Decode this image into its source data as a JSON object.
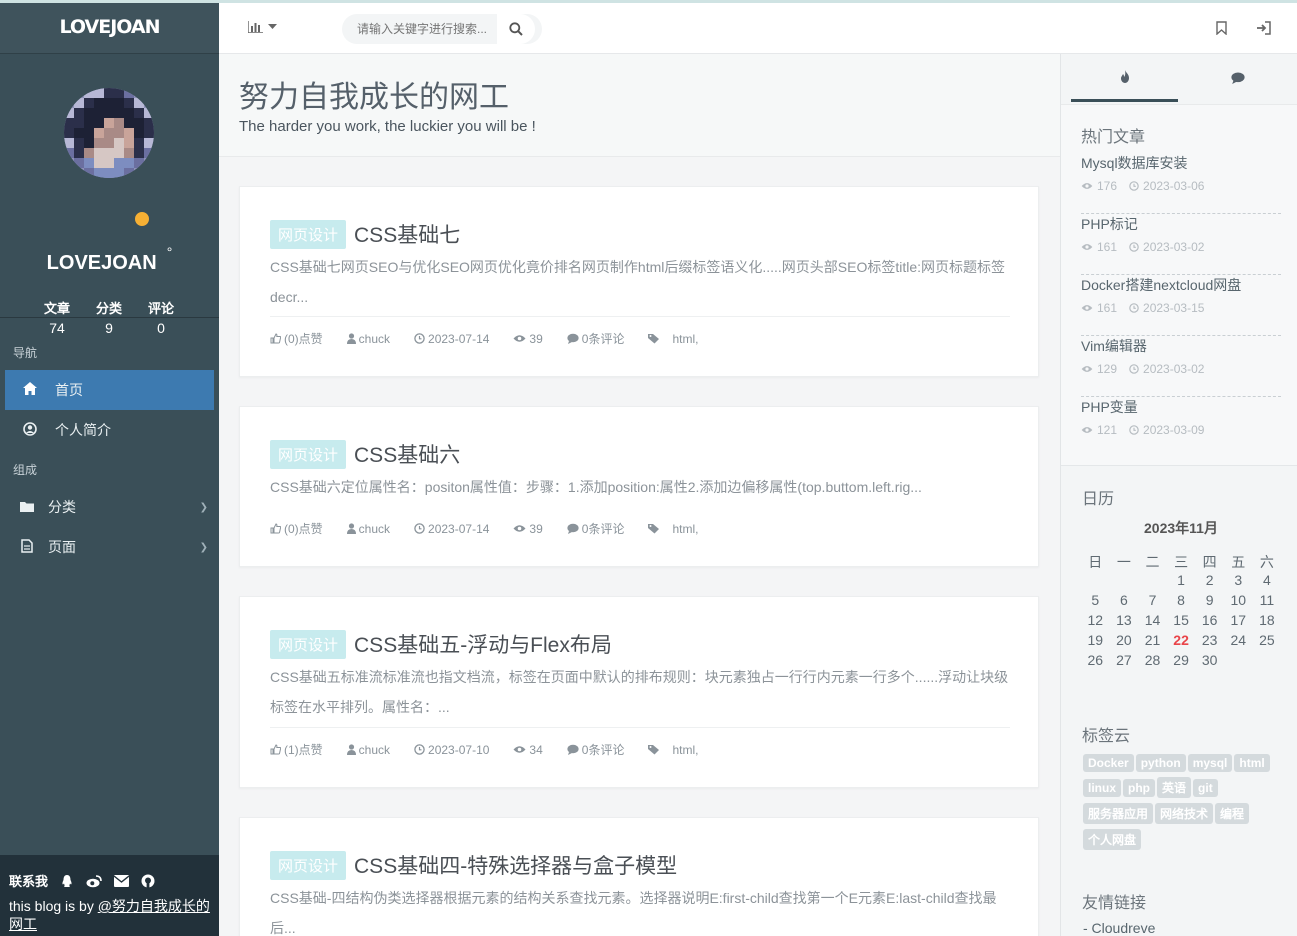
{
  "brand": "LOVEJOAN",
  "profile": {
    "name": "LOVEJOAN",
    "suffix": "°",
    "stats": [
      {
        "label": "文章",
        "value": "74"
      },
      {
        "label": "分类",
        "value": "9"
      },
      {
        "label": "评论",
        "value": "0"
      }
    ]
  },
  "nav": {
    "section1": "导航",
    "home": "首页",
    "about": "个人简介",
    "section2": "组成",
    "category": "分类",
    "pages": "页面"
  },
  "footer": {
    "contact": "联系我",
    "text": "this blog is by ",
    "link": "@努力自我成长的网工"
  },
  "search": {
    "placeholder": "请输入关键字进行搜索..."
  },
  "hero": {
    "title": "努力自我成长的网工",
    "subtitle": "The harder you work, the luckier you will be !"
  },
  "posts": [
    {
      "tag": "网页设计",
      "title": "CSS基础七",
      "excerpt": "CSS基础七网页SEO与优化SEO网页优化竟价排名网页制作html后缀标签语义化.....网页头部SEO标签title:网页标题标签decr...",
      "likes": "(0)点赞",
      "author": "chuck",
      "date": "2023-07-14",
      "views": "39",
      "comments": "0条评论",
      "tags": "html,"
    },
    {
      "tag": "网页设计",
      "title": "CSS基础六",
      "excerpt": "CSS基础六定位属性名：positon属性值：步骤：1.添加position:属性2.添加边偏移属性(top.buttom.left.rig...",
      "likes": "(0)点赞",
      "author": "chuck",
      "date": "2023-07-14",
      "views": "39",
      "comments": "0条评论",
      "tags": "html,"
    },
    {
      "tag": "网页设计",
      "title": "CSS基础五-浮动与Flex布局",
      "excerpt": "CSS基础五标准流标准流也指文档流，标签在页面中默认的排布规则：块元素独占一行行内元素一行多个......浮动让块级标签在水平排列。属性名：...",
      "likes": "(1)点赞",
      "author": "chuck",
      "date": "2023-07-10",
      "views": "34",
      "comments": "0条评论",
      "tags": "html,"
    },
    {
      "tag": "网页设计",
      "title": "CSS基础四-特殊选择器与盒子模型",
      "excerpt": "CSS基础-四结构伪类选择器根据元素的结构关系查找元素。选择器说明E:first-child查找第一个E元素E:last-child查找最后..."
    }
  ],
  "hot": {
    "title": "热门文章",
    "items": [
      {
        "title": "Mysql数据库安装",
        "views": "176",
        "date": "2023-03-06"
      },
      {
        "title": "PHP标记",
        "views": "161",
        "date": "2023-03-02"
      },
      {
        "title": "Docker搭建nextcloud网盘",
        "views": "161",
        "date": "2023-03-15"
      },
      {
        "title": "Vim编辑器",
        "views": "129",
        "date": "2023-03-02"
      },
      {
        "title": "PHP变量",
        "views": "121",
        "date": "2023-03-09"
      }
    ]
  },
  "calendar": {
    "heading": "日历",
    "month": "2023年11月",
    "weekdays": [
      "日",
      "一",
      "二",
      "三",
      "四",
      "五",
      "六"
    ],
    "weeks": [
      [
        "",
        "",
        "",
        "1",
        "2",
        "3",
        "4"
      ],
      [
        "5",
        "6",
        "7",
        "8",
        "9",
        "10",
        "11"
      ],
      [
        "12",
        "13",
        "14",
        "15",
        "16",
        "17",
        "18"
      ],
      [
        "19",
        "20",
        "21",
        "22",
        "23",
        "24",
        "25"
      ],
      [
        "26",
        "27",
        "28",
        "29",
        "30",
        "",
        ""
      ]
    ],
    "today": "22"
  },
  "tagcloud": {
    "heading": "标签云",
    "tags": [
      "Docker",
      "python",
      "mysql",
      "html",
      "linux",
      "php",
      "英语",
      "git",
      "服务器应用",
      "网络技术",
      "编程",
      "个人网盘"
    ]
  },
  "friends": {
    "heading": "友情链接",
    "items": [
      "-  Cloudreve"
    ]
  },
  "colors": {
    "accent": "#3d7ab0",
    "sidebar": "#3a4f58",
    "tag": "#c7ebee",
    "today": "#e9454a"
  }
}
